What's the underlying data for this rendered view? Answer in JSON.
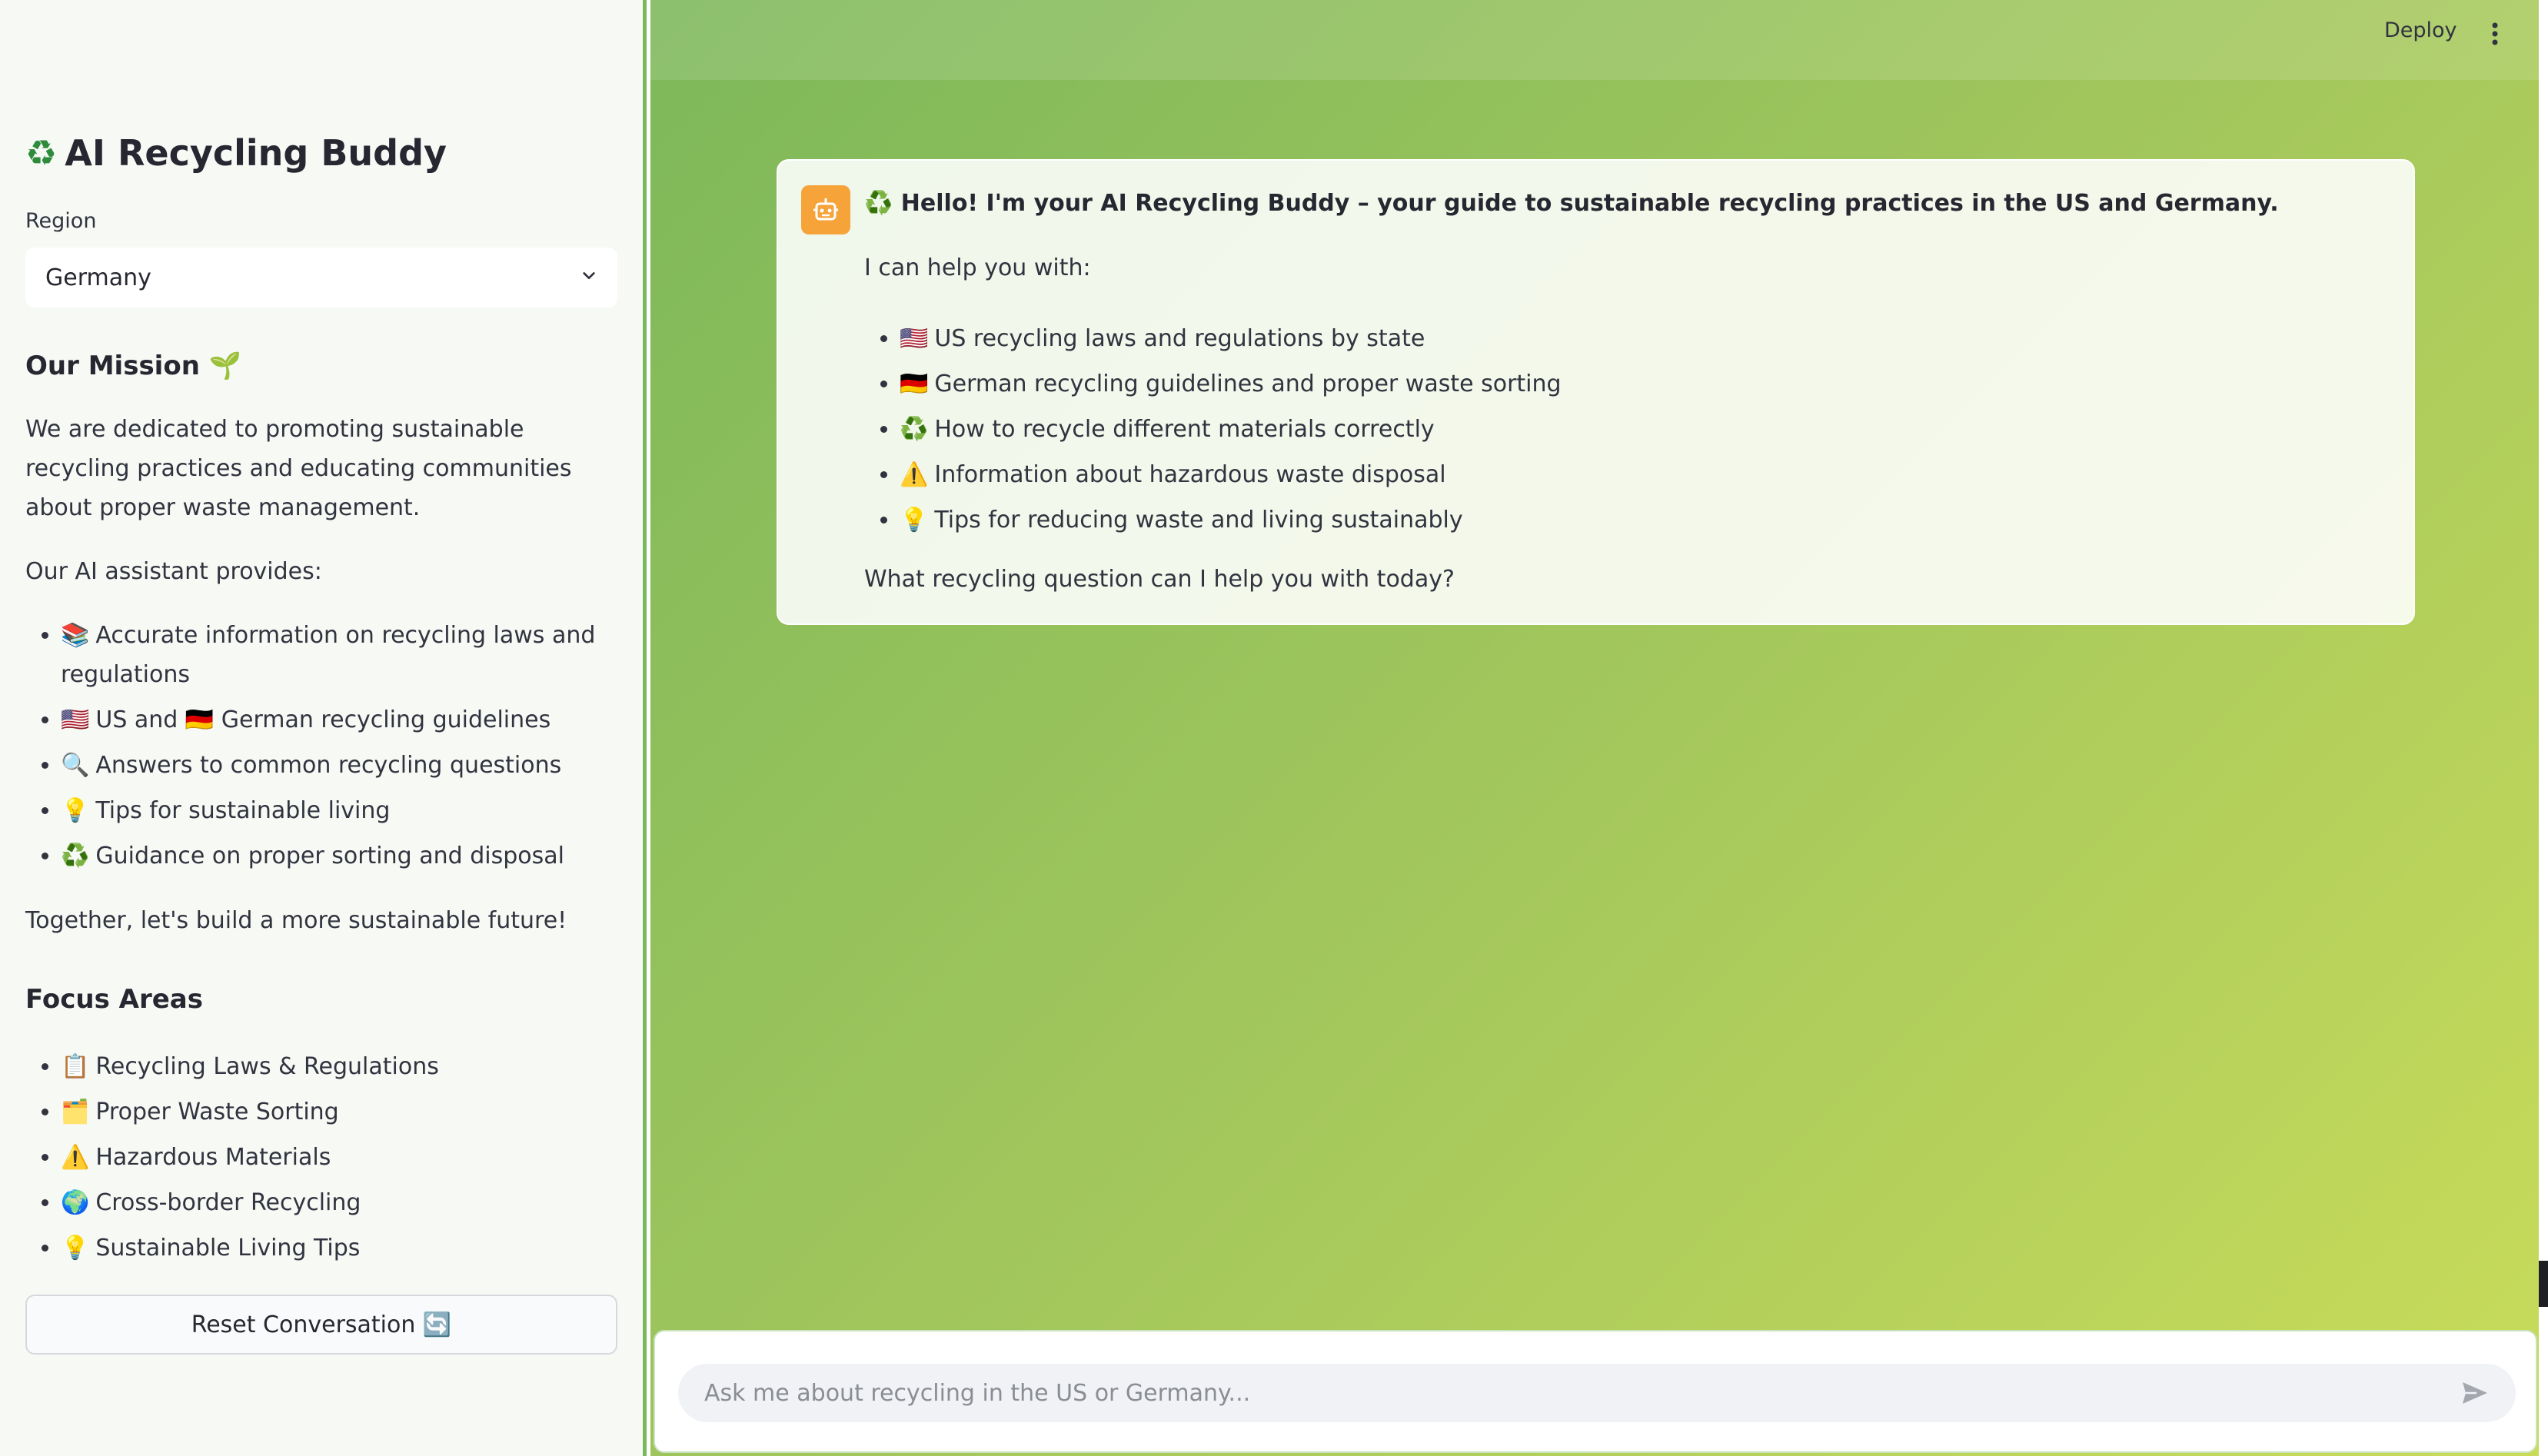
{
  "sidebar": {
    "title_icon": "recycle-icon",
    "title": "AI Recycling Buddy",
    "region": {
      "label": "Region",
      "value": "Germany"
    },
    "mission": {
      "heading": "Our Mission 🌱",
      "paragraph": "We are dedicated to promoting sustainable recycling practices and educating communities about proper waste management.",
      "intro": "Our AI assistant provides:",
      "items": [
        {
          "icon": "📚",
          "text": "Accurate information on recycling laws and regulations"
        },
        {
          "icon": "🇺🇸",
          "text": "US and 🇩🇪 German recycling guidelines"
        },
        {
          "icon": "🔍",
          "text": "Answers to common recycling questions"
        },
        {
          "icon": "💡",
          "text": "Tips for sustainable living"
        },
        {
          "icon": "♻️",
          "text": "Guidance on proper sorting and disposal"
        }
      ],
      "closing": "Together, let's build a more sustainable future!"
    },
    "focus": {
      "heading": "Focus Areas",
      "items": [
        {
          "icon": "📋",
          "text": "Recycling Laws & Regulations"
        },
        {
          "icon": "🗂️",
          "text": "Proper Waste Sorting"
        },
        {
          "icon": "⚠️",
          "text": "Hazardous Materials"
        },
        {
          "icon": "🌍",
          "text": "Cross-border Recycling"
        },
        {
          "icon": "💡",
          "text": "Sustainable Living Tips"
        }
      ]
    },
    "reset_label": "Reset Conversation 🔄"
  },
  "header": {
    "deploy_label": "Deploy"
  },
  "chat": {
    "assistant_message": {
      "heading": "♻️ Hello! I'm your AI Recycling Buddy – your guide to sustainable recycling practices in the US and Germany.",
      "intro": "I can help you with:",
      "items": [
        {
          "icon": "🇺🇸",
          "text": "US recycling laws and regulations by state"
        },
        {
          "icon": "🇩🇪",
          "text": "German recycling guidelines and proper waste sorting"
        },
        {
          "icon": "♻️",
          "text": "How to recycle different materials correctly"
        },
        {
          "icon": "⚠️",
          "text": "Information about hazardous waste disposal"
        },
        {
          "icon": "💡",
          "text": "Tips for reducing waste and living sustainably"
        }
      ],
      "closing": "What recycling question can I help you with today?"
    },
    "input": {
      "placeholder": "Ask me about recycling in the US or Germany..."
    }
  },
  "colors": {
    "accent_green": "#79b95c",
    "avatar_orange": "#f6a33a"
  }
}
